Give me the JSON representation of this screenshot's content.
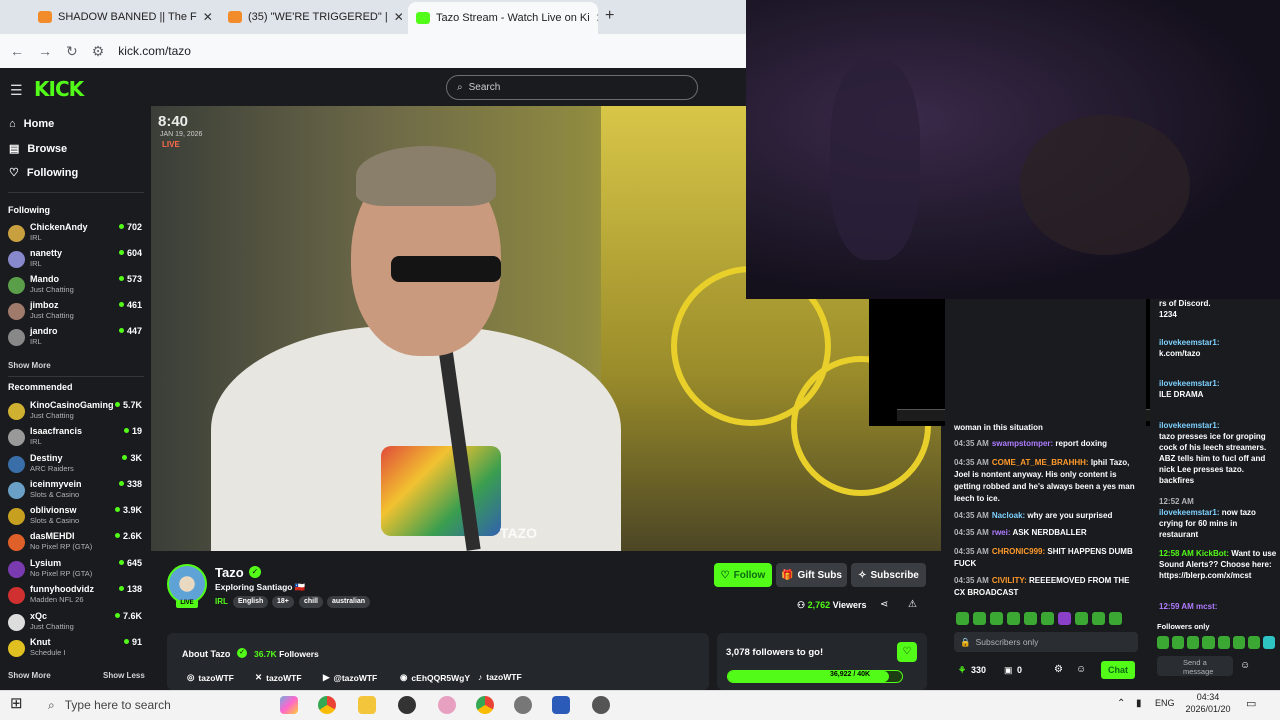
{
  "browser": {
    "tabs": [
      {
        "title": "SHADOW BANNED || The F",
        "color": "#f28b2a"
      },
      {
        "title": "(35) \"WE'RE TRIGGERED\" |",
        "color": "#f28b2a"
      },
      {
        "title": "Tazo Stream - Watch Live on Ki",
        "color": "#53fc18"
      }
    ],
    "new_tab": "+",
    "url": "kick.com/tazo"
  },
  "kick": {
    "logo": "KICK",
    "search_placeholder": "Search",
    "nav": [
      {
        "label": "Home",
        "icon": "home-icon"
      },
      {
        "label": "Browse",
        "icon": "browse-icon"
      },
      {
        "label": "Following",
        "icon": "heart-icon"
      }
    ],
    "following_heading": "Following",
    "following": [
      {
        "name": "ChickenAndy",
        "category": "IRL",
        "viewers": "702",
        "color": "#c8a040"
      },
      {
        "name": "nanetty",
        "category": "IRL",
        "viewers": "604",
        "color": "#8888cc"
      },
      {
        "name": "Mando",
        "category": "Just Chatting",
        "viewers": "573",
        "color": "#5a9e4a"
      },
      {
        "name": "jimboz",
        "category": "Just Chatting",
        "viewers": "461",
        "color": "#a07a6a"
      },
      {
        "name": "jandro",
        "category": "IRL",
        "viewers": "447",
        "color": "#888"
      }
    ],
    "show_more": "Show More",
    "recommended_heading": "Recommended",
    "recommended": [
      {
        "name": "KinoCasinoGaming",
        "category": "Just Chatting",
        "viewers": "5.7K",
        "color": "#d0b030"
      },
      {
        "name": "Isaacfrancis",
        "category": "IRL",
        "viewers": "19",
        "color": "#999"
      },
      {
        "name": "Destiny",
        "category": "ARC Raiders",
        "viewers": "3K",
        "color": "#3a6ea8"
      },
      {
        "name": "iceinmyvein",
        "category": "Slots & Casino",
        "viewers": "338",
        "color": "#6aa0c8"
      },
      {
        "name": "oblivionsw",
        "category": "Slots & Casino",
        "viewers": "3.9K",
        "color": "#c8a020"
      },
      {
        "name": "dasMEHDI",
        "category": "No Pixel RP (GTA)",
        "viewers": "2.6K",
        "color": "#e0602a"
      },
      {
        "name": "Lysium",
        "category": "No Pixel RP (GTA)",
        "viewers": "645",
        "color": "#7a3ab0"
      },
      {
        "name": "funnyhoodvidz",
        "category": "Madden NFL 26",
        "viewers": "138",
        "color": "#d03030"
      },
      {
        "name": "xQc",
        "category": "Just Chatting",
        "viewers": "7.6K",
        "color": "#ddd"
      },
      {
        "name": "Knut",
        "category": "Schedule I",
        "viewers": "91",
        "color": "#e0c020"
      }
    ],
    "show_more_bottom": "Show More",
    "show_less": "Show Less"
  },
  "video": {
    "overlay_time": "8:40",
    "overlay_date": "JAN 19, 2026",
    "overlay_live": "LIVE",
    "watermark": "TAZO"
  },
  "stream": {
    "name": "Tazo",
    "title": "Exploring Santiago 🇨🇱",
    "category": "IRL",
    "tags": [
      "English",
      "18+",
      "chill",
      "australian"
    ],
    "follow_label": "Follow",
    "gift_label": "Gift Subs",
    "subscribe_label": "Subscribe",
    "viewers_count": "2,762",
    "viewers_label": "Viewers",
    "live_badge": "LIVE"
  },
  "about": {
    "title": "About Tazo",
    "followers_count": "36.7K",
    "followers_label": "Followers",
    "socials": [
      {
        "platform": "instagram-icon",
        "handle": "tazoWTF"
      },
      {
        "platform": "x-icon",
        "handle": "tazoWTF"
      },
      {
        "platform": "youtube-icon",
        "handle": "@tazoWTF"
      },
      {
        "platform": "discord-icon",
        "handle": "cEhQQR5WgY"
      },
      {
        "platform": "tiktok-icon",
        "handle": "tazoWTF"
      }
    ]
  },
  "goal": {
    "title": "3,078 followers to go!",
    "progress_text": "36,922 / 40K",
    "progress_fraction": 0.923
  },
  "chat": {
    "messages": [
      {
        "time": "",
        "user": "",
        "text": "woman in this situation",
        "color": "#fff"
      },
      {
        "time": "04:35 AM",
        "user": "swampstomper:",
        "text": "report doxing",
        "color": "#b07cff"
      },
      {
        "time": "04:35 AM",
        "user": "COME_AT_ME_BRAHHH:",
        "text": "Iphil Tazo, Joel is nontent anyway. His only content is getting robbed and he's always been a yes man leech to ice.",
        "color": "#ff9a2a"
      },
      {
        "time": "04:35 AM",
        "user": "Nacloak:",
        "text": "why are you surprised",
        "color": "#7fd2ff"
      },
      {
        "time": "04:35 AM",
        "user": "rwei:",
        "text": "ASK NERDBALLER",
        "color": "#b07cff"
      },
      {
        "time": "04:35 AM",
        "user": "CHRONIC999:",
        "text": "SHIT HAPPENS DUMB FUCK",
        "color": "#ff9a2a"
      },
      {
        "time": "04:35 AM",
        "user": "CIVILITY:",
        "text": "REEEEMOVED FROM THE CX BROADCAST",
        "color": "#ff9a2a"
      }
    ],
    "input_placeholder": "Subscribers only",
    "points": "330",
    "zero": "0",
    "chat_button": "Chat"
  },
  "chat2": {
    "lines": [
      {
        "user": "",
        "text": "rs of Discord."
      },
      {
        "user": "",
        "text": "1234"
      },
      {
        "user": "ilovekeemstar1:",
        "text": ""
      },
      {
        "user": "",
        "text": "k.com/tazo"
      },
      {
        "user": "ilovekeemstar1:",
        "text": ""
      },
      {
        "user": "",
        "text": "ILE DRAMA"
      },
      {
        "user": "ilovekeemstar1:",
        "text": ""
      },
      {
        "user": "",
        "text": "tazo presses ice for groping cock of his leech streamers. ABZ tells him to fucl off and nick Lee presses tazo. backfires"
      },
      {
        "user": "",
        "text": "12:52 AM"
      },
      {
        "user": "ilovekeemstar1:",
        "text": "now tazo crying for 60 mins in restaurant"
      },
      {
        "user": "12:58 AM KickBot:",
        "text": "Want to use Sound Alerts?? Choose here: https://blerp.com/x/mcst"
      },
      {
        "user": "12:59 AM mcst:",
        "text": ""
      }
    ],
    "followers_only": "Followers only",
    "send_placeholder": "Send a message"
  },
  "taskbar": {
    "search_placeholder": "Type here to search",
    "lang": "ENG",
    "time": "04:34",
    "date": "2026/01/20"
  }
}
